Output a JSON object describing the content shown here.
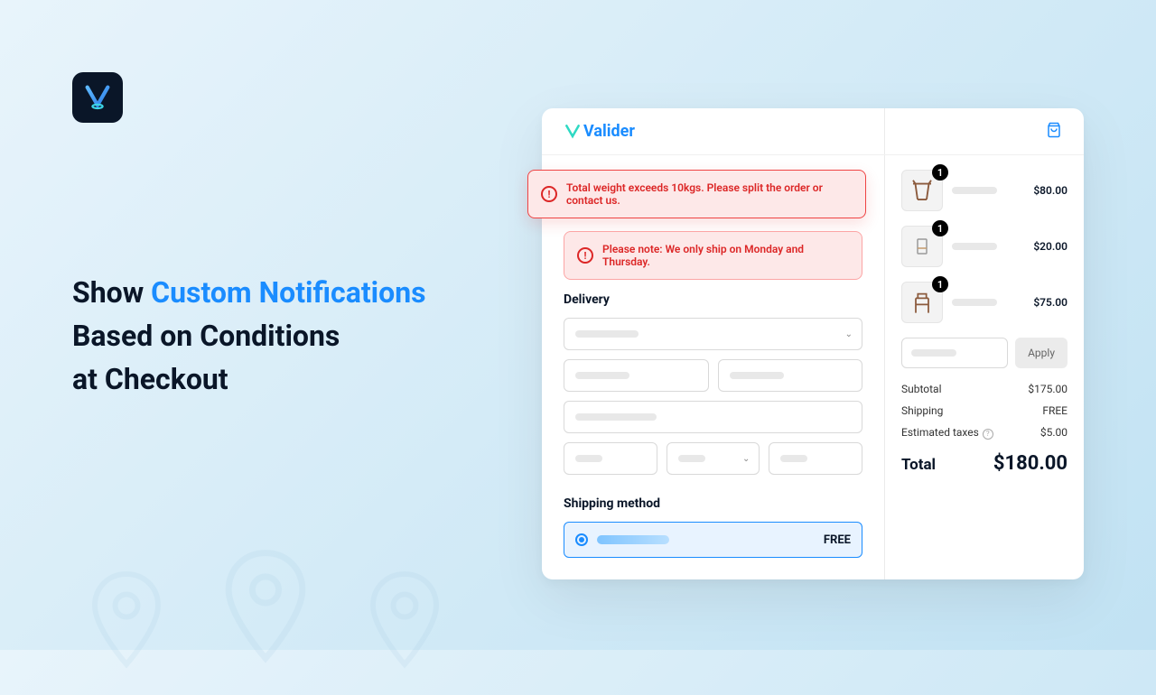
{
  "brand": "Valider",
  "headline": {
    "w1": "Show ",
    "w2": "Custom Notifications",
    "w3": "Based on Conditions",
    "w4": "at Checkout"
  },
  "alerts": [
    {
      "message": "Total weight exceeds 10kgs. Please split the order or contact us."
    },
    {
      "message": "Please note: We only ship on Monday and Thursday."
    }
  ],
  "delivery_label": "Delivery",
  "shipping_method_label": "Shipping method",
  "shipping_option_price": "FREE",
  "cart": {
    "items": [
      {
        "qty": "1",
        "price": "$80.00"
      },
      {
        "qty": "1",
        "price": "$20.00"
      },
      {
        "qty": "1",
        "price": "$75.00"
      }
    ],
    "apply_label": "Apply",
    "subtotal_label": "Subtotal",
    "subtotal_value": "$175.00",
    "shipping_label": "Shipping",
    "shipping_value": "FREE",
    "tax_label": "Estimated taxes",
    "tax_value": "$5.00",
    "total_label": "Total",
    "total_value": "$180.00"
  }
}
